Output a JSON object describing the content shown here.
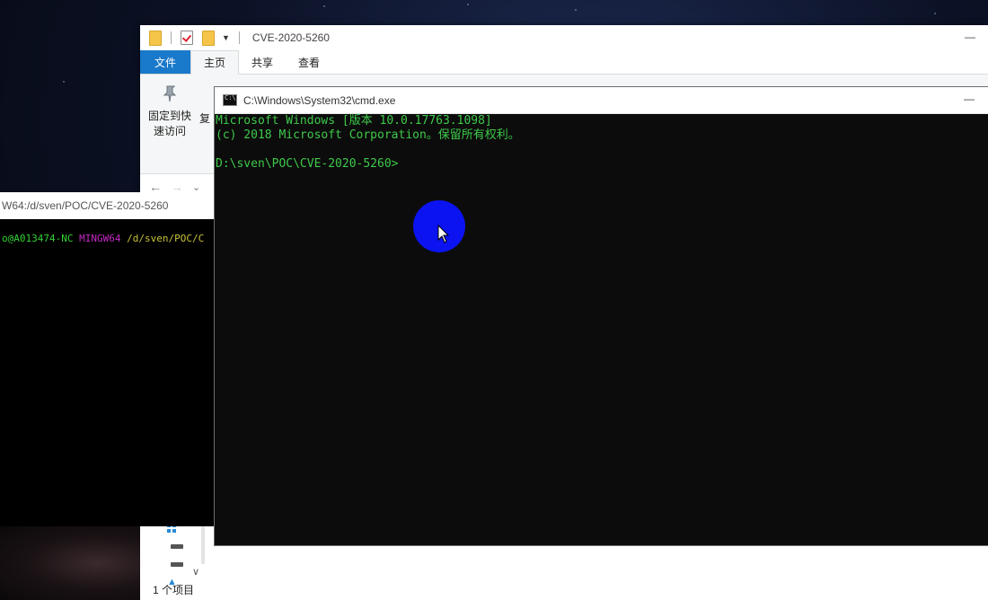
{
  "explorer": {
    "title": "CVE-2020-5260",
    "minimize_glyph": "—",
    "tabs": [
      {
        "label": "文件"
      },
      {
        "label": "主页"
      },
      {
        "label": "共享"
      },
      {
        "label": "查看"
      }
    ],
    "ribbon": {
      "pin_label_line1": "固定到快",
      "pin_label_line2": "速访问",
      "next_label": "复"
    },
    "nav": {
      "back": "←",
      "forward": "→",
      "dropdown": "⌄"
    },
    "status": "1 个项目",
    "scroll_down": "∨"
  },
  "mingw": {
    "title": "W64:/d/sven/POC/CVE-2020-5260",
    "prompt_user": "o@A013474-NC",
    "prompt_env": "MINGW64",
    "prompt_path": "/d/sven/POC/C"
  },
  "cmd": {
    "title": "C:\\Windows\\System32\\cmd.exe",
    "minimize_glyph": "—",
    "lines": [
      "Microsoft Windows [版本 10.0.17763.1098]",
      "(c) 2018 Microsoft Corporation。保留所有权利。",
      "",
      "D:\\sven\\POC\\CVE-2020-5260>"
    ]
  },
  "icons": {
    "pin": "pin-icon",
    "cmd": "cmd-icon",
    "folder": "folder-icon",
    "cursor": "mouse-pointer-icon"
  },
  "colors": {
    "cmd_text": "#3ec94a",
    "file_tab": "#1979ca",
    "click_highlight": "#0b13f0"
  }
}
